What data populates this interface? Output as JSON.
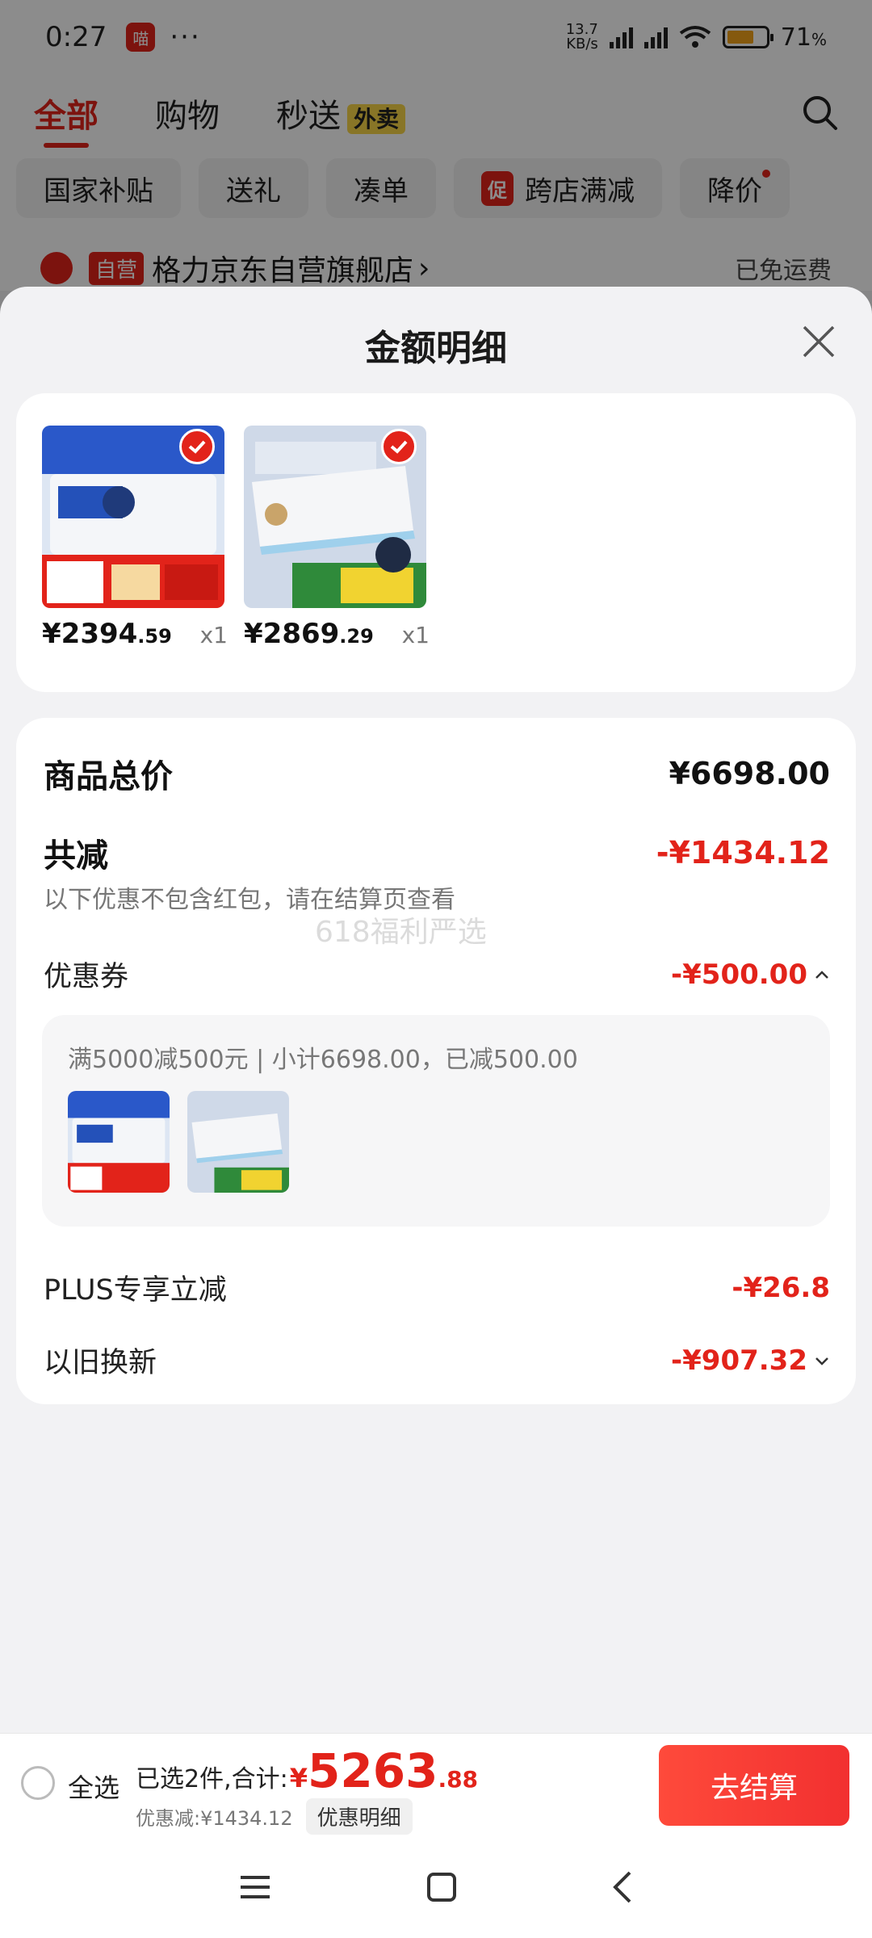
{
  "status_bar": {
    "time": "0:27",
    "app_badge": "喵",
    "more": "···",
    "net_speed_value": "13.7",
    "net_speed_unit": "KB/s",
    "battery": "71",
    "battery_unit": "%"
  },
  "tabs": [
    {
      "label": "全部"
    },
    {
      "label": "购物"
    },
    {
      "label": "秒送",
      "badge": "外卖"
    }
  ],
  "chips": [
    {
      "label": "国家补贴"
    },
    {
      "label": "送礼"
    },
    {
      "label": "凑单"
    },
    {
      "label": "跨店满减",
      "tag": "促"
    },
    {
      "label": "降价"
    }
  ],
  "store": {
    "tag": "自营",
    "name": "格力京东自营旗舰店",
    "chevron": "›",
    "shipping": "已免运费"
  },
  "sheet": {
    "title": "金额明细"
  },
  "products": [
    {
      "price_int": "¥2394",
      "price_dec": ".59",
      "qty": "x1"
    },
    {
      "price_int": "¥2869",
      "price_dec": ".29",
      "qty": "x1"
    }
  ],
  "summary": {
    "total_label": "商品总价",
    "total_value": "¥6698.00",
    "reduce_label": "共减",
    "reduce_value": "-¥1434.12",
    "note": "以下优惠不包含红包，请在结算页查看",
    "watermark": "618福利严选",
    "coupon_label": "优惠券",
    "coupon_value": "-¥500.00",
    "coupon_desc": "满5000减500元 | 小计6698.00，已减500.00",
    "plus_label": "PLUS专享立减",
    "plus_value": "-¥26.8",
    "tradein_label": "以旧换新",
    "tradein_value": "-¥907.32"
  },
  "checkout": {
    "select_all": "全选",
    "selected_text": "已选2件,合计:",
    "yen": "¥",
    "total_int": "5263",
    "total_dec": ".88",
    "discount_text": "优惠减:¥1434.12",
    "detail_btn": "优惠明细",
    "pay_btn": "去结算"
  },
  "colors": {
    "accent": "#e2231a",
    "background": "#f2f2f4"
  }
}
